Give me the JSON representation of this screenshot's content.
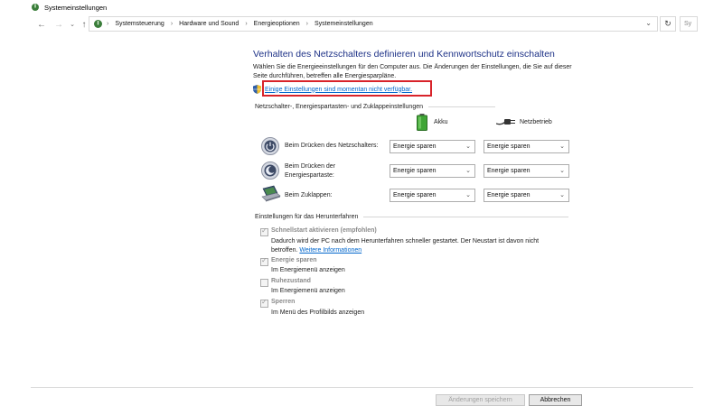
{
  "window": {
    "title": "Systemeinstellungen"
  },
  "nav": {
    "back_icon": "arrow-left-icon",
    "forward_icon": "arrow-right-icon",
    "recent_icon": "chevron-down-icon",
    "up_icon": "arrow-up-icon",
    "breadcrumbs": [
      "Systemsteuerung",
      "Hardware und Sound",
      "Energieoptionen",
      "Systemeinstellungen"
    ],
    "search_placeholder": "Sy"
  },
  "page": {
    "title": "Verhalten des Netzschalters definieren und Kennwortschutz einschalten",
    "description": "Wählen Sie die Energieeinstellungen für den Computer aus. Die Änderungen der Einstellungen, die Sie auf dieser Seite durchführen, betreffen alle Energiesparpläne.",
    "admin_link": "Einige Einstellungen sind momentan nicht verfügbar.",
    "highlight_color": "#d8232a"
  },
  "buttons_section": {
    "heading": "Netzschalter-, Energiespartasten- und Zuklappeinstellungen",
    "col_battery": "Akku",
    "col_plugged": "Netzbetrieb",
    "rows": [
      {
        "label": "Beim Drücken des Netzschalters:",
        "battery": "Energie sparen",
        "plugged": "Energie sparen"
      },
      {
        "label": "Beim Drücken der Energiespartaste:",
        "battery": "Energie sparen",
        "plugged": "Energie sparen"
      },
      {
        "label": "Beim Zuklappen:",
        "battery": "Energie sparen",
        "plugged": "Energie sparen"
      }
    ]
  },
  "shutdown_section": {
    "heading": "Einstellungen für das Herunterfahren",
    "items": [
      {
        "label": "Schnellstart aktivieren (empfohlen)",
        "checked": true,
        "desc": "Dadurch wird der PC nach dem Herunterfahren schneller gestartet. Der Neustart ist davon nicht betroffen.",
        "link": "Weitere Informationen"
      },
      {
        "label": "Energie sparen",
        "checked": true,
        "desc": "Im Energiemenü anzeigen"
      },
      {
        "label": "Ruhezustand",
        "checked": false,
        "desc": "Im Energiemenü anzeigen"
      },
      {
        "label": "Sperren",
        "checked": true,
        "desc": "Im Menü des Profilbilds anzeigen"
      }
    ]
  },
  "footer": {
    "save_label": "Änderungen speichern",
    "cancel_label": "Abbrechen"
  }
}
